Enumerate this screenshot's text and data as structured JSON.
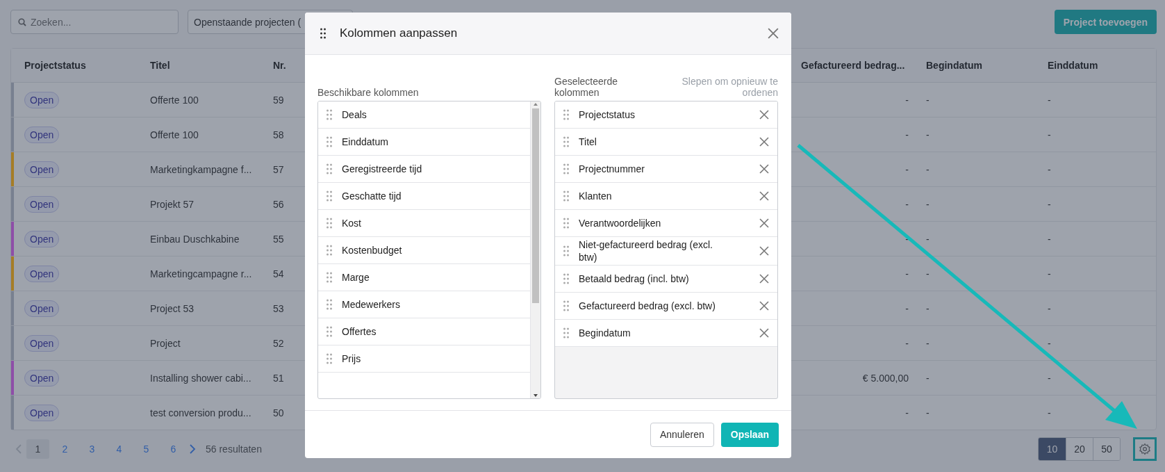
{
  "toolbar": {
    "search": {
      "placeholder": "Zoeken..."
    },
    "filter": {
      "value": "Openstaande projecten ("
    },
    "add_button": "Project toevoegen"
  },
  "table": {
    "columns": [
      "Projectstatus",
      "Titel",
      "Nr.",
      "Gefactureerd bedrag...",
      "Begindatum",
      "Einddatum"
    ],
    "rows": [
      {
        "color": "#788090",
        "status": "Open",
        "title": "Offerte 100",
        "nr": "59",
        "billed": "-",
        "start": "-",
        "end": "-"
      },
      {
        "color": "#788090",
        "status": "Open",
        "title": "Offerte 100",
        "nr": "58",
        "billed": "-",
        "start": "-",
        "end": "-"
      },
      {
        "color": "#a57d27",
        "status": "Open",
        "title": "Marketingkampagne f...",
        "nr": "57",
        "billed": "-",
        "start": "-",
        "end": "-"
      },
      {
        "color": "#788090",
        "status": "Open",
        "title": "Projekt 57",
        "nr": "56",
        "billed": "-",
        "start": "-",
        "end": "-"
      },
      {
        "color": "#8e4ea8",
        "status": "Open",
        "title": "Einbau Duschkabine",
        "nr": "55",
        "billed": "-",
        "start": "-",
        "end": "-"
      },
      {
        "color": "#a57d27",
        "status": "Open",
        "title": "Marketingcampagne r...",
        "nr": "54",
        "billed": "-",
        "start": "-",
        "end": "-"
      },
      {
        "color": "#788090",
        "status": "Open",
        "title": "Project 53",
        "nr": "53",
        "billed": "-",
        "start": "-",
        "end": "-"
      },
      {
        "color": "#788090",
        "status": "Open",
        "title": "Project",
        "nr": "52",
        "billed": "-",
        "start": "-",
        "end": "-"
      },
      {
        "color": "#8e4ea8",
        "status": "Open",
        "title": "Installing shower cabi...",
        "nr": "51",
        "billed": "€ 5.000,00",
        "start": "-",
        "end": "-"
      },
      {
        "color": "#788090",
        "status": "Open",
        "title": "test conversion produ...",
        "nr": "50",
        "billed": "-",
        "start": "-",
        "end": "-"
      }
    ]
  },
  "pagination": {
    "pages": [
      {
        "label": "1",
        "selected": true
      },
      {
        "label": "2",
        "selected": false
      },
      {
        "label": "3",
        "selected": false
      },
      {
        "label": "4",
        "selected": false
      },
      {
        "label": "5",
        "selected": false
      },
      {
        "label": "6",
        "selected": false
      }
    ],
    "results": "56 resultaten",
    "page_sizes": [
      {
        "label": "10",
        "selected": true
      },
      {
        "label": "20",
        "selected": false
      },
      {
        "label": "50",
        "selected": false
      }
    ]
  },
  "modal": {
    "title": "Kolommen aanpassen",
    "available_label": "Beschikbare kolommen",
    "selected_label": "Geselecteerde kolommen",
    "hint": "Slepen om opnieuw te ordenen",
    "available": [
      "Deals",
      "Einddatum",
      "Geregistreerde tijd",
      "Geschatte tijd",
      "Kost",
      "Kostenbudget",
      "Marge",
      "Medewerkers",
      "Offertes",
      "Prijs"
    ],
    "selected": [
      "Projectstatus",
      "Titel",
      "Projectnummer",
      "Klanten",
      "Verantwoordelijken",
      "Niet-gefactureerd bedrag (excl. btw)",
      "Betaald bedrag (incl. btw)",
      "Gefactureerd bedrag (excl. btw)",
      "Begindatum"
    ],
    "cancel": "Annuleren",
    "save": "Opslaan"
  }
}
